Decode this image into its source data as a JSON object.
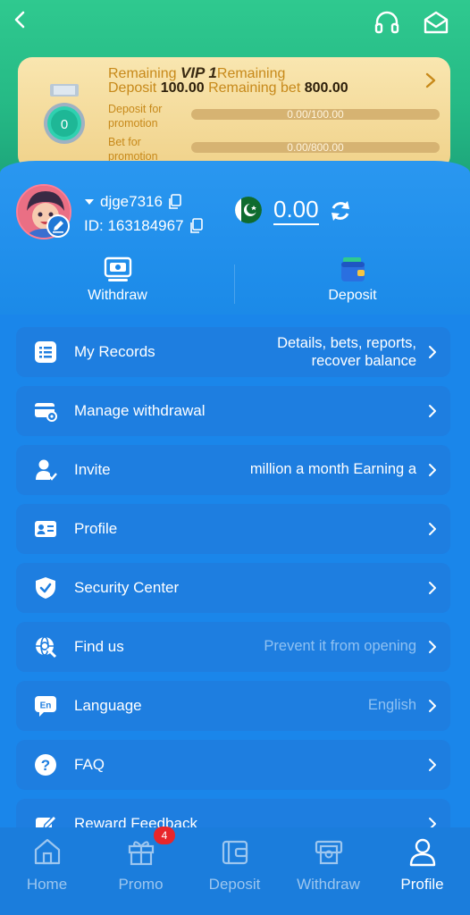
{
  "colors": {
    "header_green": "#25b985",
    "page_blue": "#1a86ea",
    "row_blue": "#1e7ee0",
    "gold_card": "#f5dc9e",
    "gold_text": "#c7891a"
  },
  "header": {
    "back_icon": "chevron-left-icon",
    "support_icon": "headset-icon",
    "message_icon": "mailbox-icon"
  },
  "vip": {
    "medal_level": "0",
    "remaining_1": "Remaining ",
    "vip_level": "VIP 1",
    "remaining_2": "Remaining",
    "deposit_word": "Deposit ",
    "deposit_amount": "100.00",
    "remaining_bet_word": " Remaining bet ",
    "bet_amount": "800.00",
    "deposit_label": "Deposit for promotion",
    "deposit_progress": "0.00/100.00",
    "deposit_fraction": 0,
    "bet_label": "Bet for promotion",
    "bet_progress": "0.00/800.00",
    "bet_fraction": 0
  },
  "user": {
    "username": "djge7316",
    "id_text": "ID: 163184967",
    "balance": "0.00",
    "flag": "pakistan-flag"
  },
  "quick_actions": {
    "withdraw": "Withdraw",
    "deposit": "Deposit"
  },
  "menu": [
    {
      "label": "My Records",
      "desc_line1": "Details, bets, reports,",
      "desc_line2": "recover balance",
      "icon": "list-icon"
    },
    {
      "label": "Manage withdrawal",
      "desc": "",
      "icon": "card-settings-icon"
    },
    {
      "label": "Invite",
      "desc": "million a month  Earning a",
      "icon": "user-invite-icon"
    },
    {
      "label": "Profile",
      "desc": "",
      "icon": "id-card-icon"
    },
    {
      "label": "Security Center",
      "desc": "",
      "icon": "shield-check-icon"
    },
    {
      "label": "Find us",
      "desc": "Prevent it from opening",
      "icon": "globe-search-icon"
    },
    {
      "label": "Language",
      "desc": "English",
      "icon": "language-icon"
    },
    {
      "label": "FAQ",
      "desc": "",
      "icon": "question-icon"
    },
    {
      "label": "Reward Feedback",
      "desc": "",
      "icon": "feedback-icon"
    }
  ],
  "bottom_nav": {
    "home": "Home",
    "promo": "Promo",
    "promo_badge": "4",
    "deposit": "Deposit",
    "withdraw": "Withdraw",
    "profile": "Profile",
    "active": "Profile"
  }
}
